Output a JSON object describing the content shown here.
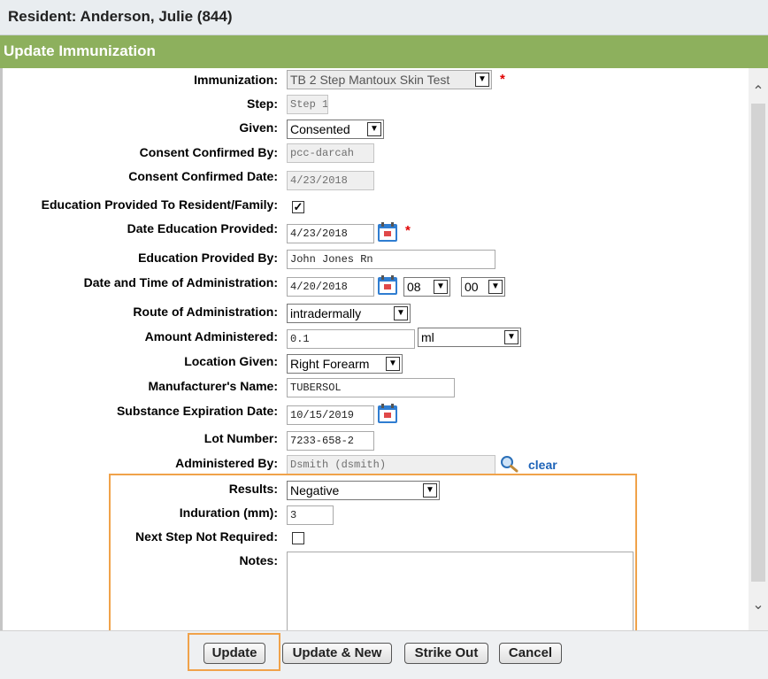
{
  "header": {
    "title": "Resident: Anderson, Julie (844)"
  },
  "section": {
    "title": "Update Immunization"
  },
  "form": {
    "immunization": {
      "label": "Immunization:",
      "value": "TB 2 Step Mantoux Skin Test"
    },
    "step": {
      "label": "Step:",
      "value": "Step 1"
    },
    "given": {
      "label": "Given:",
      "value": "Consented"
    },
    "consent_confirmed_by": {
      "label": "Consent Confirmed By:",
      "value": "pcc-darcah"
    },
    "consent_confirmed_date": {
      "label": "Consent Confirmed Date:",
      "value": "4/23/2018"
    },
    "education_provided": {
      "label": "Education Provided To Resident/Family:",
      "checked": true
    },
    "date_education_provided": {
      "label": "Date Education Provided:",
      "value": "4/23/2018"
    },
    "education_provided_by": {
      "label": "Education Provided By:",
      "value": "John Jones Rn"
    },
    "date_time_administration": {
      "label": "Date and Time of Administration:",
      "date": "4/20/2018",
      "hour": "08",
      "minute": "00"
    },
    "route": {
      "label": "Route of Administration:",
      "value": "intradermally"
    },
    "amount": {
      "label": "Amount Administered:",
      "value": "0.1",
      "unit": "ml"
    },
    "location": {
      "label": "Location Given:",
      "value": "Right Forearm"
    },
    "manufacturer": {
      "label": "Manufacturer's Name:",
      "value": "TUBERSOL"
    },
    "expiration": {
      "label": "Substance Expiration Date:",
      "value": "10/15/2019"
    },
    "lot": {
      "label": "Lot Number:",
      "value": "7233-658-2"
    },
    "administered_by": {
      "label": "Administered By:",
      "value": "Dsmith (dsmith)",
      "clear_label": "clear"
    },
    "results": {
      "label": "Results:",
      "value": "Negative"
    },
    "induration": {
      "label": "Induration (mm):",
      "value": "3"
    },
    "next_step": {
      "label": "Next Step Not Required:",
      "checked": false
    },
    "notes": {
      "label": "Notes:",
      "value": ""
    },
    "required_mark": "*"
  },
  "buttons": {
    "update": "Update",
    "update_new": "Update & New",
    "strike_out": "Strike Out",
    "cancel": "Cancel"
  },
  "colors": {
    "section_bar": "#8db05d",
    "highlight": "#f0a24a",
    "link": "#1d63b8",
    "required": "#e00000"
  }
}
